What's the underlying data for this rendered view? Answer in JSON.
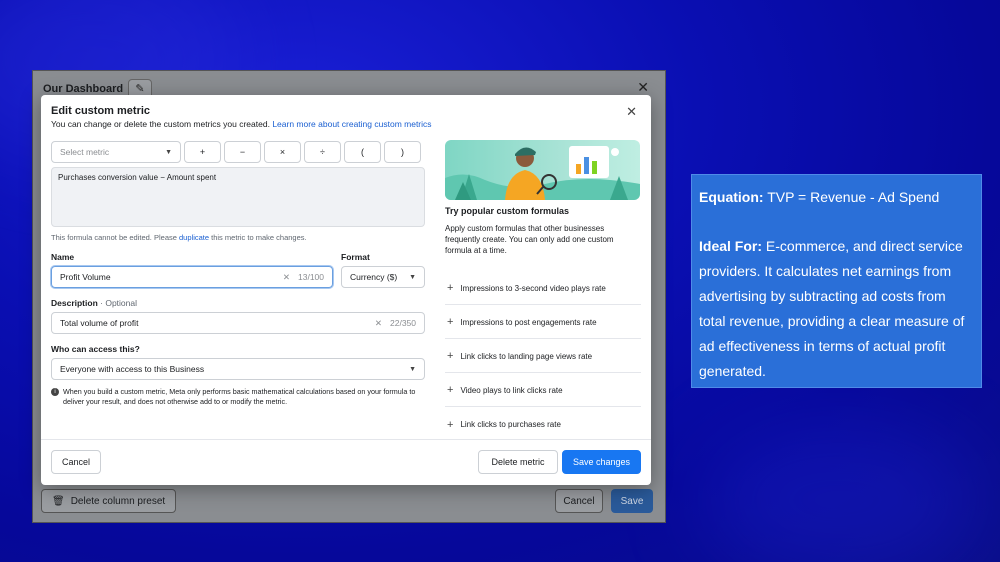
{
  "dashboard": {
    "title": "Our Dashboard",
    "edit_icon": "pencil-icon",
    "close_icon": "close-icon",
    "delete_preset_label": "Delete column preset",
    "cancel_label": "Cancel",
    "save_label": "Save"
  },
  "modal": {
    "title": "Edit custom metric",
    "subtitle_text": "You can change or delete the custom metrics you created.",
    "subtitle_link": "Learn more about creating custom metrics",
    "close_icon": "close-icon",
    "select_metric_placeholder": "Select metric",
    "operators": [
      "+",
      "−",
      "×",
      "÷",
      "(",
      ")"
    ],
    "formula_text": "Purchases conversion value − Amount spent",
    "formula_note_before": "This formula cannot be edited. Please",
    "formula_note_link": "duplicate",
    "formula_note_after": "this metric to make changes.",
    "name_label": "Name",
    "name_value": "Profit Volume",
    "name_counter": "13/100",
    "format_label": "Format",
    "format_value": "Currency ($)",
    "description_label": "Description",
    "description_optional": "· Optional",
    "description_value": "Total volume of profit",
    "description_counter": "22/350",
    "access_label": "Who can access this?",
    "access_value": "Everyone with access to this Business",
    "info_text": "When you build a custom metric, Meta only performs basic mathematical calculations based on your formula to deliver your result, and does not otherwise add to or modify the metric.",
    "popular_title": "Try popular custom formulas",
    "popular_desc": "Apply custom formulas that other businesses frequently create. You can only add one custom formula at a time.",
    "popular_formulas": [
      "Impressions to 3-second video plays rate",
      "Impressions to post engagements rate",
      "Link clicks to landing page views rate",
      "Video plays to link clicks rate",
      "Link clicks to purchases rate"
    ],
    "cancel_label": "Cancel",
    "delete_label": "Delete metric",
    "save_label": "Save changes"
  },
  "callout": {
    "equation_label": "Equation:",
    "equation_text": "TVP = Revenue - Ad Spend",
    "ideal_label": "Ideal For:",
    "ideal_text": "E-commerce, and direct service providers. It calculates net earnings from advertising by subtracting ad costs from total revenue, providing a clear measure of ad effectiveness in terms of actual profit generated."
  },
  "colors": {
    "background": "#0a0fb3",
    "callout": "#2a6fd8",
    "primary": "#1877f2",
    "link": "#1a5fd1"
  }
}
